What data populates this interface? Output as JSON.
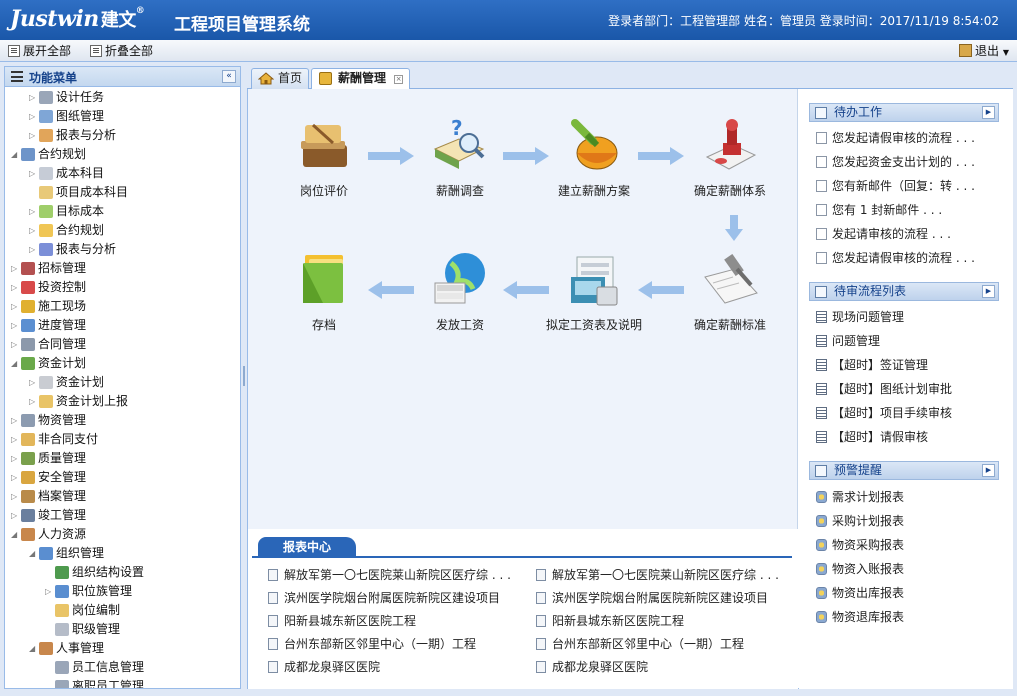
{
  "header": {
    "logo_latin": "Justwin",
    "logo_cn": "建文",
    "logo_reg": "®",
    "system_title": "工程项目管理系统",
    "login_info": "登录者部门：工程管理部 姓名：管理员 登录时间：2017/11/19 8:54:02"
  },
  "toolbar": {
    "expand_all": "展开全部",
    "collapse_all": "折叠全部",
    "exit": "退出"
  },
  "sidebar": {
    "title": "功能菜单",
    "collapse_glyph": "«",
    "items": [
      {
        "label": "设计任务",
        "level": 2,
        "arrow": "▷",
        "icon_color": "#9aa6b8"
      },
      {
        "label": "图纸管理",
        "level": 2,
        "arrow": "▷",
        "icon_color": "#7fa6d6"
      },
      {
        "label": "报表与分析",
        "level": 2,
        "arrow": "▷",
        "icon_color": "#e1a55a"
      },
      {
        "label": "合约规划",
        "level": 1,
        "arrow": "◢",
        "icon_color": "#6d94c9"
      },
      {
        "label": "成本科目",
        "level": 2,
        "arrow": "▷",
        "icon_color": "#c6ccd6"
      },
      {
        "label": "项目成本科目",
        "level": 2,
        "arrow": "",
        "icon_color": "#e8c978"
      },
      {
        "label": "目标成本",
        "level": 2,
        "arrow": "▷",
        "icon_color": "#9fce6a"
      },
      {
        "label": "合约规划",
        "level": 2,
        "arrow": "▷",
        "icon_color": "#f0c655"
      },
      {
        "label": "报表与分析",
        "level": 2,
        "arrow": "▷",
        "icon_color": "#7c8fd8"
      },
      {
        "label": "招标管理",
        "level": 1,
        "arrow": "▷",
        "icon_color": "#b35050"
      },
      {
        "label": "投资控制",
        "level": 1,
        "arrow": "▷",
        "icon_color": "#d84a4a"
      },
      {
        "label": "施工现场",
        "level": 1,
        "arrow": "▷",
        "icon_color": "#e0b030"
      },
      {
        "label": "进度管理",
        "level": 1,
        "arrow": "▷",
        "icon_color": "#5b8fd1"
      },
      {
        "label": "合同管理",
        "level": 1,
        "arrow": "▷",
        "icon_color": "#8c99ab"
      },
      {
        "label": "资金计划",
        "level": 1,
        "arrow": "◢",
        "icon_color": "#6aa94a"
      },
      {
        "label": "资金计划",
        "level": 2,
        "arrow": "▷",
        "icon_color": "#c9ccd2"
      },
      {
        "label": "资金计划上报",
        "level": 2,
        "arrow": "▷",
        "icon_color": "#e9c467"
      },
      {
        "label": "物资管理",
        "level": 1,
        "arrow": "▷",
        "icon_color": "#8c9bb0"
      },
      {
        "label": "非合同支付",
        "level": 1,
        "arrow": "▷",
        "icon_color": "#e2b65a"
      },
      {
        "label": "质量管理",
        "level": 1,
        "arrow": "▷",
        "icon_color": "#7aa04c"
      },
      {
        "label": "安全管理",
        "level": 1,
        "arrow": "▷",
        "icon_color": "#d9a640"
      },
      {
        "label": "档案管理",
        "level": 1,
        "arrow": "▷",
        "icon_color": "#b98b4a"
      },
      {
        "label": "竣工管理",
        "level": 1,
        "arrow": "▷",
        "icon_color": "#6a7f9e"
      },
      {
        "label": "人力资源",
        "level": 1,
        "arrow": "◢",
        "icon_color": "#c8874c"
      },
      {
        "label": "组织管理",
        "level": 2,
        "arrow": "◢",
        "icon_color": "#5a8ed0"
      },
      {
        "label": "组织结构设置",
        "level": 3,
        "arrow": "",
        "icon_color": "#4e9a4e"
      },
      {
        "label": "职位族管理",
        "level": 3,
        "arrow": "▷",
        "icon_color": "#5a8ed0"
      },
      {
        "label": "岗位编制",
        "level": 3,
        "arrow": "",
        "icon_color": "#e9c467"
      },
      {
        "label": "职级管理",
        "level": 3,
        "arrow": "",
        "icon_color": "#b5bcc8"
      },
      {
        "label": "人事管理",
        "level": 2,
        "arrow": "◢",
        "icon_color": "#c8874c"
      },
      {
        "label": "员工信息管理",
        "level": 3,
        "arrow": "",
        "icon_color": "#9aa6b8"
      },
      {
        "label": "离职员工管理",
        "level": 3,
        "arrow": "",
        "icon_color": "#9aa6b8"
      }
    ]
  },
  "tabs": [
    {
      "label": "首页",
      "active": false
    },
    {
      "label": "薪酬管理",
      "active": true
    }
  ],
  "tab_close_glyph": "×",
  "flow": {
    "steps": [
      {
        "label": "岗位评价"
      },
      {
        "label": "薪酬调查"
      },
      {
        "label": "建立薪酬方案"
      },
      {
        "label": "确定薪酬体系"
      },
      {
        "label": "确定薪酬标准"
      },
      {
        "label": "拟定工资表及说明"
      },
      {
        "label": "发放工资"
      },
      {
        "label": "存档"
      }
    ]
  },
  "report_center": {
    "title": "报表中心",
    "items": [
      "解放军第一〇七医院莱山新院区医疗综 . . .",
      "解放军第一〇七医院莱山新院区医疗综 . . .",
      "滨州医学院烟台附属医院新院区建设项目",
      "滨州医学院烟台附属医院新院区建设项目",
      "阳新县城东新区医院工程",
      "阳新县城东新区医院工程",
      "台州东部新区邻里中心（一期）工程",
      "台州东部新区邻里中心（一期）工程",
      "成都龙泉驿区医院",
      "成都龙泉驿区医院"
    ]
  },
  "panels": {
    "more_glyph": "▶",
    "todo": {
      "title": "待办工作",
      "items": [
        "您发起请假审核的流程 . . .",
        "您发起资金支出计划的 . . .",
        "您有新邮件（回复：转 . . .",
        "您有 1 封新邮件 . . .",
        "发起请审核的流程 . . .",
        "您发起请假审核的流程 . . ."
      ]
    },
    "review": {
      "title": "待审流程列表",
      "items": [
        "现场问题管理",
        "问题管理",
        "【超时】签证管理",
        "【超时】图纸计划审批",
        "【超时】项目手续审核",
        "【超时】请假审核"
      ]
    },
    "alerts": {
      "title": "预警提醒",
      "items": [
        "需求计划报表",
        "采购计划报表",
        "物资采购报表",
        "物资入账报表",
        "物资出库报表",
        "物资退库报表"
      ]
    }
  },
  "icons": {
    "toolbar_expand": "expand-all-icon",
    "toolbar_collapse": "collapse-all-icon",
    "exit": "exit-door-icon",
    "menu": "menu-list-icon",
    "home": "home-icon",
    "salary": "money-icon"
  }
}
